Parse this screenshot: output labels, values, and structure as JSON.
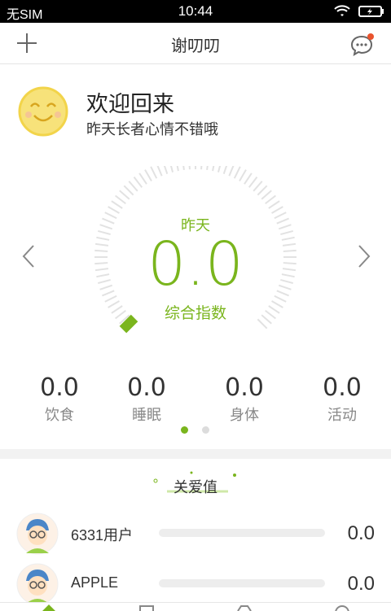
{
  "status_bar": {
    "carrier": "无SIM",
    "time": "10:44"
  },
  "navbar": {
    "title": "谢叨叨"
  },
  "welcome": {
    "greeting": "欢迎回来",
    "message": "昨天长者心情不错哦"
  },
  "gauge": {
    "day_label": "昨天",
    "score": "0.0",
    "label": "综合指数"
  },
  "metrics": [
    {
      "value": "0.0",
      "label": "饮食"
    },
    {
      "value": "0.0",
      "label": "睡眠"
    },
    {
      "value": "0.0",
      "label": "身体"
    },
    {
      "value": "0.0",
      "label": "活动"
    }
  ],
  "pager": {
    "count": 2,
    "active": 0
  },
  "care": {
    "title": "关爱值",
    "users": [
      {
        "name": "6331用户",
        "value": "0.0",
        "progress": 0
      },
      {
        "name": "APPLE",
        "value": "0.0",
        "progress": 0
      }
    ]
  },
  "colors": {
    "accent": "#7ab51d",
    "smiley": "#f2d44a",
    "badge": "#e9532d"
  },
  "icons": [
    "add-icon",
    "chat-icon",
    "smiley-icon",
    "chevron-left-icon",
    "chevron-right-icon",
    "avatar-icon"
  ]
}
